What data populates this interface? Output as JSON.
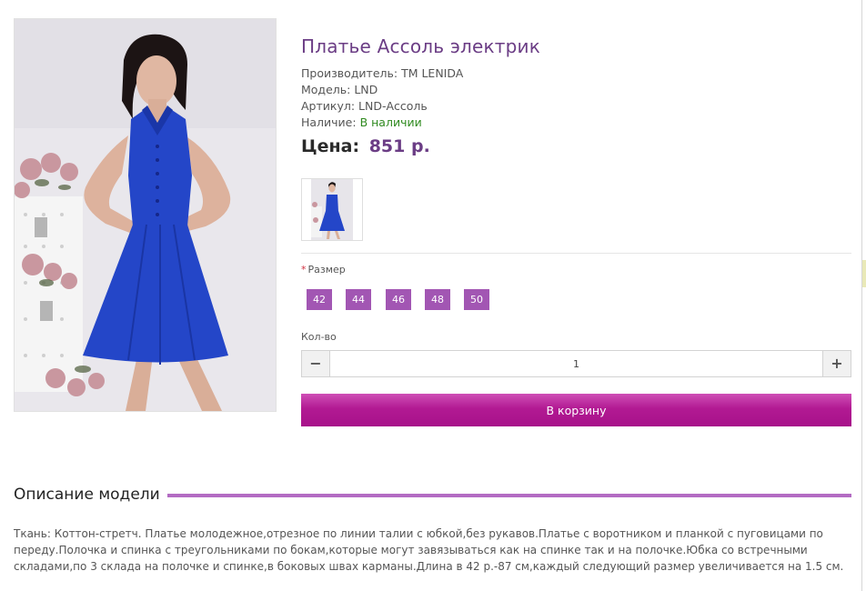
{
  "product": {
    "title": "Платье Ассоль электрик",
    "manufacturer_label": "Производитель:",
    "manufacturer": "TM LENIDA",
    "model_label": "Модель:",
    "model": "LND",
    "sku_label": "Артикул:",
    "sku": "LND-Ассоль",
    "availability_label": "Наличие:",
    "availability": "В наличии",
    "price_label": "Цена:",
    "price": "851 р."
  },
  "options": {
    "required_mark": "*",
    "size_label": "Размер",
    "sizes": [
      "42",
      "44",
      "46",
      "48",
      "50"
    ],
    "qty_label": "Кол-во",
    "qty_value": "1",
    "minus_icon": "minus-icon",
    "plus_icon": "plus-icon"
  },
  "cart": {
    "button_label": "В корзину"
  },
  "description": {
    "heading": "Описание модели",
    "text": "Ткань: Коттон-стретч. Платье молодежное,отрезное по линии талии с юбкой,без рукавов.Платье с воротником и планкой с пуговицами по переду.Полочка и спинка с треугольниками по бокам,которые могут завязываться как на спинке так и на полочке.Юбка со встречными складами,по 3 склада на полочке и спинке,в боковых швах карманы.Длина в 42 р.-87 см,каждый следующий размер увеличивается на 1.5 см."
  },
  "colors": {
    "accent_purple": "#6b3d85",
    "size_chip": "#a256b3",
    "cart_button": "#b21a93",
    "in_stock": "#2f8a1f",
    "dress_blue": "#2244c8"
  }
}
